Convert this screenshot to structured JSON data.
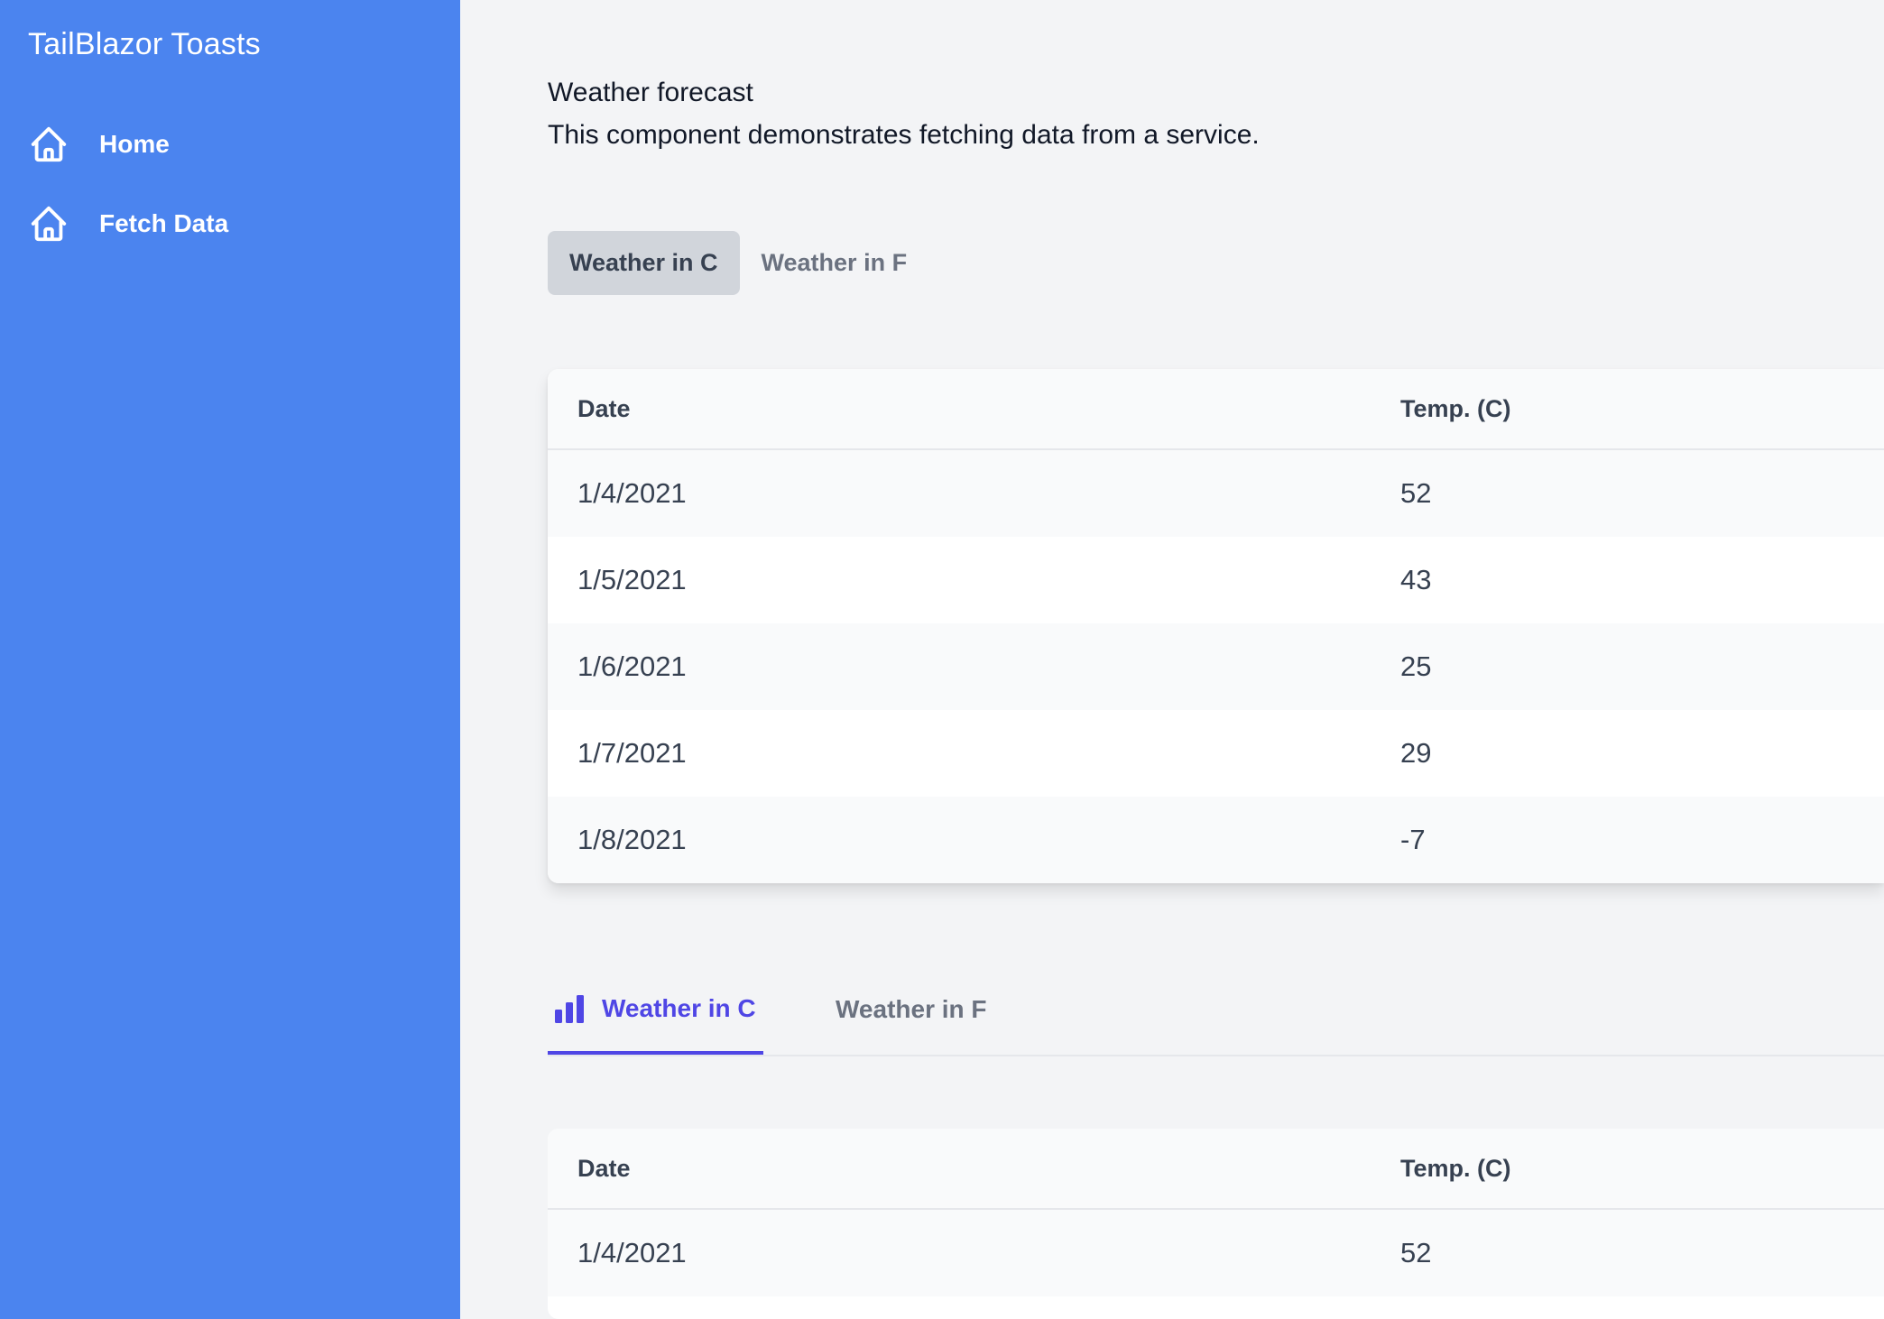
{
  "app": {
    "brand": "TailBlazor Toasts"
  },
  "sidebar": {
    "items": [
      {
        "label": "Home",
        "icon": "home-icon"
      },
      {
        "label": "Fetch Data",
        "icon": "home-icon"
      }
    ]
  },
  "page": {
    "title": "Weather forecast",
    "subtitle": "This component demonstrates fetching data from a service."
  },
  "pill_tabs": [
    {
      "label": "Weather in C",
      "active": true
    },
    {
      "label": "Weather in F",
      "active": false
    }
  ],
  "table1": {
    "headers": [
      "Date",
      "Temp. (C)"
    ],
    "rows": [
      [
        "1/4/2021",
        "52"
      ],
      [
        "1/5/2021",
        "43"
      ],
      [
        "1/6/2021",
        "25"
      ],
      [
        "1/7/2021",
        "29"
      ],
      [
        "1/8/2021",
        "-7"
      ]
    ]
  },
  "line_tabs": [
    {
      "label": "Weather in C",
      "active": true,
      "icon": "bar-chart-icon"
    },
    {
      "label": "Weather in F",
      "active": false
    }
  ],
  "table2": {
    "headers": [
      "Date",
      "Temp. (C)"
    ],
    "rows": [
      [
        "1/4/2021",
        "52"
      ]
    ]
  },
  "colors": {
    "sidebar": "#4b84ef",
    "accent": "#4f46e5",
    "background": "#f3f4f6"
  }
}
